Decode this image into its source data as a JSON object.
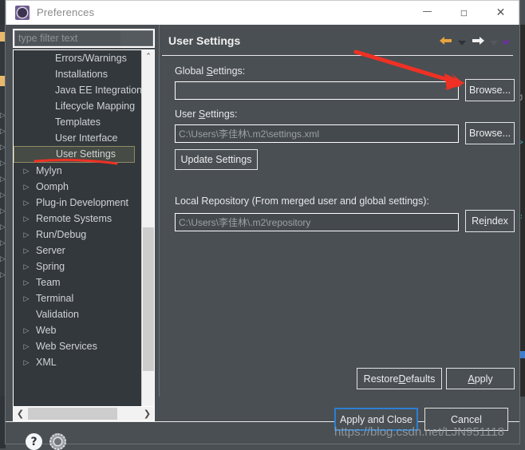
{
  "window": {
    "title": "Preferences",
    "icon": "preferences-gear-icon",
    "controls": {
      "minimize": "—",
      "maximize": "▢",
      "close": "✕"
    }
  },
  "filter": {
    "placeholder": "type filter text",
    "value": ""
  },
  "tree": {
    "items": [
      {
        "label": "Errors/Warnings",
        "level": 2,
        "expandable": false,
        "selected": false
      },
      {
        "label": "Installations",
        "level": 2,
        "expandable": false,
        "selected": false
      },
      {
        "label": "Java EE Integration",
        "level": 2,
        "expandable": false,
        "selected": false
      },
      {
        "label": "Lifecycle Mapping",
        "level": 2,
        "expandable": false,
        "selected": false
      },
      {
        "label": "Templates",
        "level": 2,
        "expandable": false,
        "selected": false
      },
      {
        "label": "User Interface",
        "level": 2,
        "expandable": false,
        "selected": false
      },
      {
        "label": "User Settings",
        "level": 2,
        "expandable": false,
        "selected": true
      },
      {
        "label": "Mylyn",
        "level": 1,
        "expandable": true,
        "selected": false
      },
      {
        "label": "Oomph",
        "level": 1,
        "expandable": true,
        "selected": false
      },
      {
        "label": "Plug-in Development",
        "level": 1,
        "expandable": true,
        "selected": false
      },
      {
        "label": "Remote Systems",
        "level": 1,
        "expandable": true,
        "selected": false
      },
      {
        "label": "Run/Debug",
        "level": 1,
        "expandable": true,
        "selected": false
      },
      {
        "label": "Server",
        "level": 1,
        "expandable": true,
        "selected": false
      },
      {
        "label": "Spring",
        "level": 1,
        "expandable": true,
        "selected": false
      },
      {
        "label": "Team",
        "level": 1,
        "expandable": true,
        "selected": false
      },
      {
        "label": "Terminal",
        "level": 1,
        "expandable": true,
        "selected": false
      },
      {
        "label": "Validation",
        "level": 1,
        "expandable": false,
        "selected": false
      },
      {
        "label": "Web",
        "level": 1,
        "expandable": true,
        "selected": false
      },
      {
        "label": "Web Services",
        "level": 1,
        "expandable": true,
        "selected": false
      },
      {
        "label": "XML",
        "level": 1,
        "expandable": true,
        "selected": false
      }
    ],
    "expand_arrow": "▷",
    "scrollbar": {
      "up": "⌃",
      "down": "⌄",
      "left": "❮",
      "right": "❯"
    }
  },
  "panel": {
    "title": "User Settings",
    "nav": {
      "back": "back-arrow-icon",
      "back_menu": "chevron-down-icon",
      "forward": "forward-arrow-icon",
      "forward_menu": "chevron-down-icon",
      "view_menu": "chevron-down-icon"
    },
    "fields": {
      "global_settings": {
        "label_pre": "Global ",
        "label_key": "S",
        "label_post": "ettings:",
        "value": "",
        "browse": "Browse..."
      },
      "user_settings": {
        "label_pre": "User ",
        "label_key": "S",
        "label_post": "ettings:",
        "value": "C:\\Users\\李佳林\\.m2\\settings.xml",
        "browse": "Browse..."
      },
      "update_settings_button": "Update Settings",
      "local_repository": {
        "label": "Local Repository (From merged user and global settings):",
        "value": "C:\\Users\\李佳林\\.m2\\repository",
        "reindex_pre": "Re",
        "reindex_key": "i",
        "reindex_post": "ndex"
      }
    },
    "buttons": {
      "restore_defaults_pre": "Restore ",
      "restore_defaults_key": "D",
      "restore_defaults_post": "efaults",
      "apply_pre": "",
      "apply_key": "A",
      "apply_post": "pply"
    }
  },
  "footer": {
    "help_icon": "?",
    "gear_icon": "settings-gear-icon",
    "apply_and_close": "Apply and Close",
    "cancel": "Cancel"
  },
  "annotations": {
    "watermark": "https://blog.csdn.net/LJN951118",
    "arrow_color": "#ee3124",
    "underline_color": "#ee3124"
  },
  "colors": {
    "dialog_bg": "#4a4f53",
    "tree_bg": "#33383c",
    "titlebar_bg": "#ffffff",
    "accent_blue": "#2a7fd4",
    "selection_border": "#8d8a66"
  }
}
